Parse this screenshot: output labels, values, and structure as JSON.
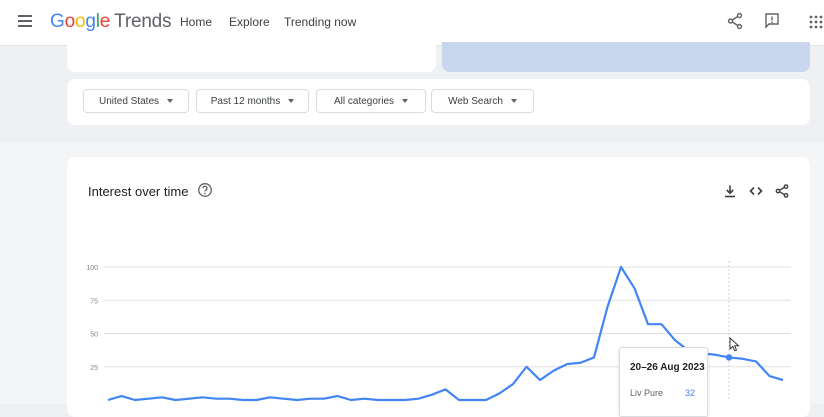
{
  "header": {
    "logo_google": [
      "G",
      "o",
      "o",
      "g",
      "l",
      "e"
    ],
    "logo_product": "Trends",
    "nav": [
      {
        "label": "Home"
      },
      {
        "label": "Explore"
      },
      {
        "label": "Trending now"
      }
    ],
    "active_tab": "Explore"
  },
  "filters": [
    {
      "label": "United States"
    },
    {
      "label": "Past 12 months"
    },
    {
      "label": "All categories"
    },
    {
      "label": "Web Search"
    }
  ],
  "chart_card": {
    "title": "Interest over time",
    "icons": [
      "help-icon",
      "download-icon",
      "embed-icon",
      "share-icon"
    ]
  },
  "chart_data": {
    "type": "line",
    "y_ticks": [
      "100",
      "75",
      "50",
      "25"
    ],
    "ylim": [
      0,
      100
    ],
    "grid": true,
    "series": [
      {
        "name": "Liv Pure",
        "color": "#4285f4",
        "values": [
          0,
          3,
          0,
          1,
          2,
          0,
          1,
          2,
          1,
          1,
          0,
          0,
          2,
          1,
          0,
          1,
          1,
          3,
          0,
          1,
          0,
          0,
          0,
          1,
          4,
          8,
          0,
          0,
          0,
          5,
          12,
          25,
          15,
          22,
          27,
          28,
          32,
          70,
          100,
          84,
          57,
          57,
          45,
          37,
          35,
          34,
          32,
          31,
          29,
          18,
          15
        ]
      }
    ],
    "tooltip": {
      "date": "20–26 Aug 2023",
      "series": "Liv Pure",
      "value": "32"
    },
    "highlight_index": 46
  },
  "colors": {
    "accent": "#1a73e8",
    "line": "#4285f4",
    "highlight_band": "#c8d7ee"
  }
}
